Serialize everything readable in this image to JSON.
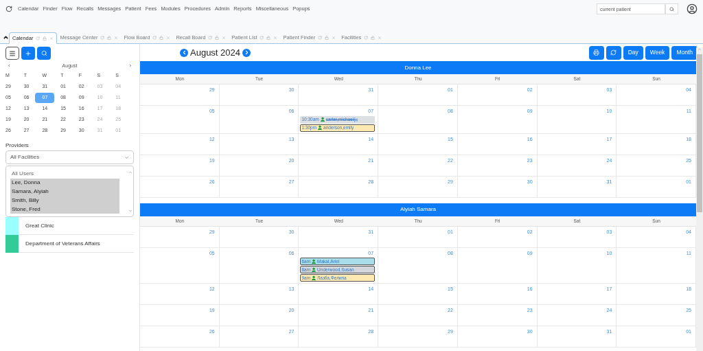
{
  "nav": {
    "menu": [
      "Calendar",
      "Finder",
      "Flow",
      "Recalls",
      "Messages",
      "Patient",
      "Fees",
      "Modules",
      "Procedures",
      "Admin",
      "Reports",
      "Miscellaneous",
      "Popups"
    ],
    "search": {
      "placeholder": "current patient"
    }
  },
  "tabs": [
    {
      "label": "Calendar",
      "selected": true
    },
    {
      "label": "Message Center",
      "selected": false
    },
    {
      "label": "Flow Board",
      "selected": false
    },
    {
      "label": "Recall Board",
      "selected": false
    },
    {
      "label": "Patient List",
      "selected": false
    },
    {
      "label": "Patient Finder",
      "selected": false
    },
    {
      "label": "Facilities",
      "selected": false
    }
  ],
  "mini_calendar": {
    "month": "August",
    "prev": "‹",
    "next": "›",
    "weekdays": [
      "M",
      "T",
      "W",
      "T",
      "F",
      "S",
      "S"
    ],
    "weeks": [
      [
        {
          "day": "29",
          "selected": false
        },
        {
          "day": "30",
          "selected": false
        },
        {
          "day": "31",
          "selected": false
        },
        {
          "day": "01",
          "selected": false
        },
        {
          "day": "02",
          "selected": false
        },
        {
          "day": "03",
          "selected": false
        },
        {
          "day": "04",
          "selected": false
        }
      ],
      [
        {
          "day": "05",
          "selected": false
        },
        {
          "day": "06",
          "selected": false
        },
        {
          "day": "07",
          "selected": true
        },
        {
          "day": "08",
          "selected": false
        },
        {
          "day": "09",
          "selected": false
        },
        {
          "day": "10",
          "selected": false
        },
        {
          "day": "11",
          "selected": false
        }
      ],
      [
        {
          "day": "12",
          "selected": false
        },
        {
          "day": "13",
          "selected": false
        },
        {
          "day": "14",
          "selected": false
        },
        {
          "day": "15",
          "selected": false
        },
        {
          "day": "16",
          "selected": false
        },
        {
          "day": "17",
          "selected": false
        },
        {
          "day": "18",
          "selected": false
        }
      ],
      [
        {
          "day": "19",
          "selected": false
        },
        {
          "day": "20",
          "selected": false
        },
        {
          "day": "21",
          "selected": false
        },
        {
          "day": "22",
          "selected": false
        },
        {
          "day": "23",
          "selected": false
        },
        {
          "day": "24",
          "selected": false
        },
        {
          "day": "25",
          "selected": false
        }
      ],
      [
        {
          "day": "26",
          "selected": false
        },
        {
          "day": "27",
          "selected": false
        },
        {
          "day": "28",
          "selected": false
        },
        {
          "day": "29",
          "selected": false
        },
        {
          "day": "30",
          "selected": false
        },
        {
          "day": "31",
          "selected": false
        },
        {
          "day": "01",
          "selected": false
        }
      ]
    ]
  },
  "providers": {
    "label": "Providers",
    "facility_select": "All Facilities",
    "users": [
      {
        "name": "All Users",
        "selected": false
      },
      {
        "name": "Lee, Donna",
        "selected": true
      },
      {
        "name": "Samara, Alyiah",
        "selected": true
      },
      {
        "name": "Smith, Billy",
        "selected": true
      },
      {
        "name": "Stone, Fred",
        "selected": true
      }
    ]
  },
  "facilities": [
    {
      "name": "Great Clinic",
      "color": "#99ffff"
    },
    {
      "name": "Department of Veterans Affairs",
      "color": "#33cc99"
    }
  ],
  "calendar": {
    "title": "August 2024",
    "views": [
      "Day",
      "Week",
      "Month"
    ],
    "providers": [
      {
        "name": "Donna Lee",
        "weekdays": [
          "Mon",
          "Tue",
          "Wed",
          "Thu",
          "Fri",
          "Sat",
          "Sun"
        ],
        "weeks": [
          [
            {
              "date": "29"
            },
            {
              "date": "30"
            },
            {
              "date": "31"
            },
            {
              "date": "01"
            },
            {
              "date": "02"
            },
            {
              "date": "03"
            },
            {
              "date": "04"
            }
          ],
          [
            {
              "date": "05"
            },
            {
              "date": "06"
            },
            {
              "date": "07",
              "appointments": [
                {
                  "time": "10:30am",
                  "patient": "carter,michael(;;",
                  "color": "#dde0e3",
                  "canceled": true
                },
                {
                  "time": "1:30pm",
                  "patient": "anderson,emily",
                  "color": "#ffe9b3",
                  "canceled": false
                }
              ]
            },
            {
              "date": "08"
            },
            {
              "date": "09"
            },
            {
              "date": "10"
            },
            {
              "date": "11"
            }
          ],
          [
            {
              "date": "12"
            },
            {
              "date": "13"
            },
            {
              "date": "14"
            },
            {
              "date": "15"
            },
            {
              "date": "16"
            },
            {
              "date": "17"
            },
            {
              "date": "18"
            }
          ],
          [
            {
              "date": "19"
            },
            {
              "date": "20"
            },
            {
              "date": "21"
            },
            {
              "date": "22"
            },
            {
              "date": "23"
            },
            {
              "date": "24"
            },
            {
              "date": "25"
            }
          ],
          [
            {
              "date": "26"
            },
            {
              "date": "27"
            },
            {
              "date": "28"
            },
            {
              "date": "29"
            },
            {
              "date": "30"
            },
            {
              "date": "31"
            },
            {
              "date": "01"
            }
          ]
        ]
      },
      {
        "name": "Alyiah Samara",
        "weekdays": [
          "Mon",
          "Tue",
          "Wed",
          "Thu",
          "Fri",
          "Sat",
          "Sun"
        ],
        "weeks": [
          [
            {
              "date": "29"
            },
            {
              "date": "30"
            },
            {
              "date": "31"
            },
            {
              "date": "01"
            },
            {
              "date": "02"
            },
            {
              "date": "03"
            },
            {
              "date": "04"
            }
          ],
          [
            {
              "date": "05"
            },
            {
              "date": "06"
            },
            {
              "date": "07",
              "appointments": [
                {
                  "time": "6am",
                  "patient": "Makai,Ariel",
                  "color": "#a8dde9",
                  "canceled": false
                },
                {
                  "time": "8am",
                  "patient": "Underwood,Susan",
                  "color": "#d3d6db",
                  "canceled": false
                },
                {
                  "time": "9am",
                  "patient": "Лазба,Фелипа",
                  "color": "#ffe9b3",
                  "canceled": false
                }
              ]
            },
            {
              "date": "08"
            },
            {
              "date": "09"
            },
            {
              "date": "10"
            },
            {
              "date": "11"
            }
          ],
          [
            {
              "date": "12"
            },
            {
              "date": "13"
            },
            {
              "date": "14"
            },
            {
              "date": "15"
            },
            {
              "date": "16"
            },
            {
              "date": "17"
            },
            {
              "date": "18"
            }
          ],
          [
            {
              "date": "19"
            },
            {
              "date": "20"
            },
            {
              "date": "21"
            },
            {
              "date": "22"
            },
            {
              "date": "23"
            },
            {
              "date": "24"
            },
            {
              "date": "25"
            }
          ],
          [
            {
              "date": "26"
            },
            {
              "date": "27"
            },
            {
              "date": "28"
            },
            {
              "date": "29"
            },
            {
              "date": "30"
            },
            {
              "date": "31"
            },
            {
              "date": "01"
            }
          ]
        ]
      }
    ]
  }
}
